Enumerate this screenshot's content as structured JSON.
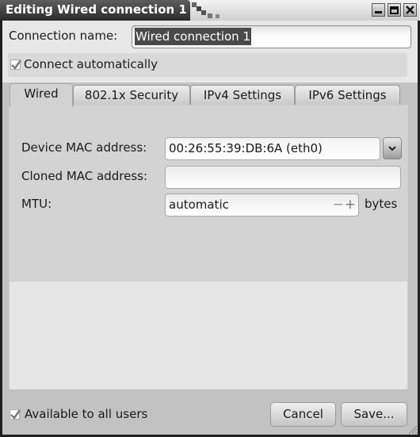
{
  "window": {
    "title": "Editing Wired connection 1",
    "controls": [
      "minimize",
      "maximize",
      "close"
    ]
  },
  "connection": {
    "name_label": "Connection name:",
    "name_value": "Wired connection 1",
    "auto_label": "Connect automatically",
    "auto_checked": true
  },
  "tabs": [
    {
      "label": "Wired",
      "active": true
    },
    {
      "label": "802.1x Security",
      "active": false
    },
    {
      "label": "IPv4 Settings",
      "active": false
    },
    {
      "label": "IPv6 Settings",
      "active": false
    }
  ],
  "wired": {
    "device_mac_label": "Device MAC address:",
    "device_mac_value": "00:26:55:39:DB:6A (eth0)",
    "cloned_mac_label": "Cloned MAC address:",
    "cloned_mac_value": "",
    "mtu_label": "MTU:",
    "mtu_value": "automatic",
    "mtu_minus": "−",
    "mtu_plus": "+",
    "mtu_unit": "bytes"
  },
  "footer": {
    "all_users_label": "Available to all users",
    "all_users_checked": true,
    "cancel_label": "Cancel",
    "save_label": "Save..."
  }
}
